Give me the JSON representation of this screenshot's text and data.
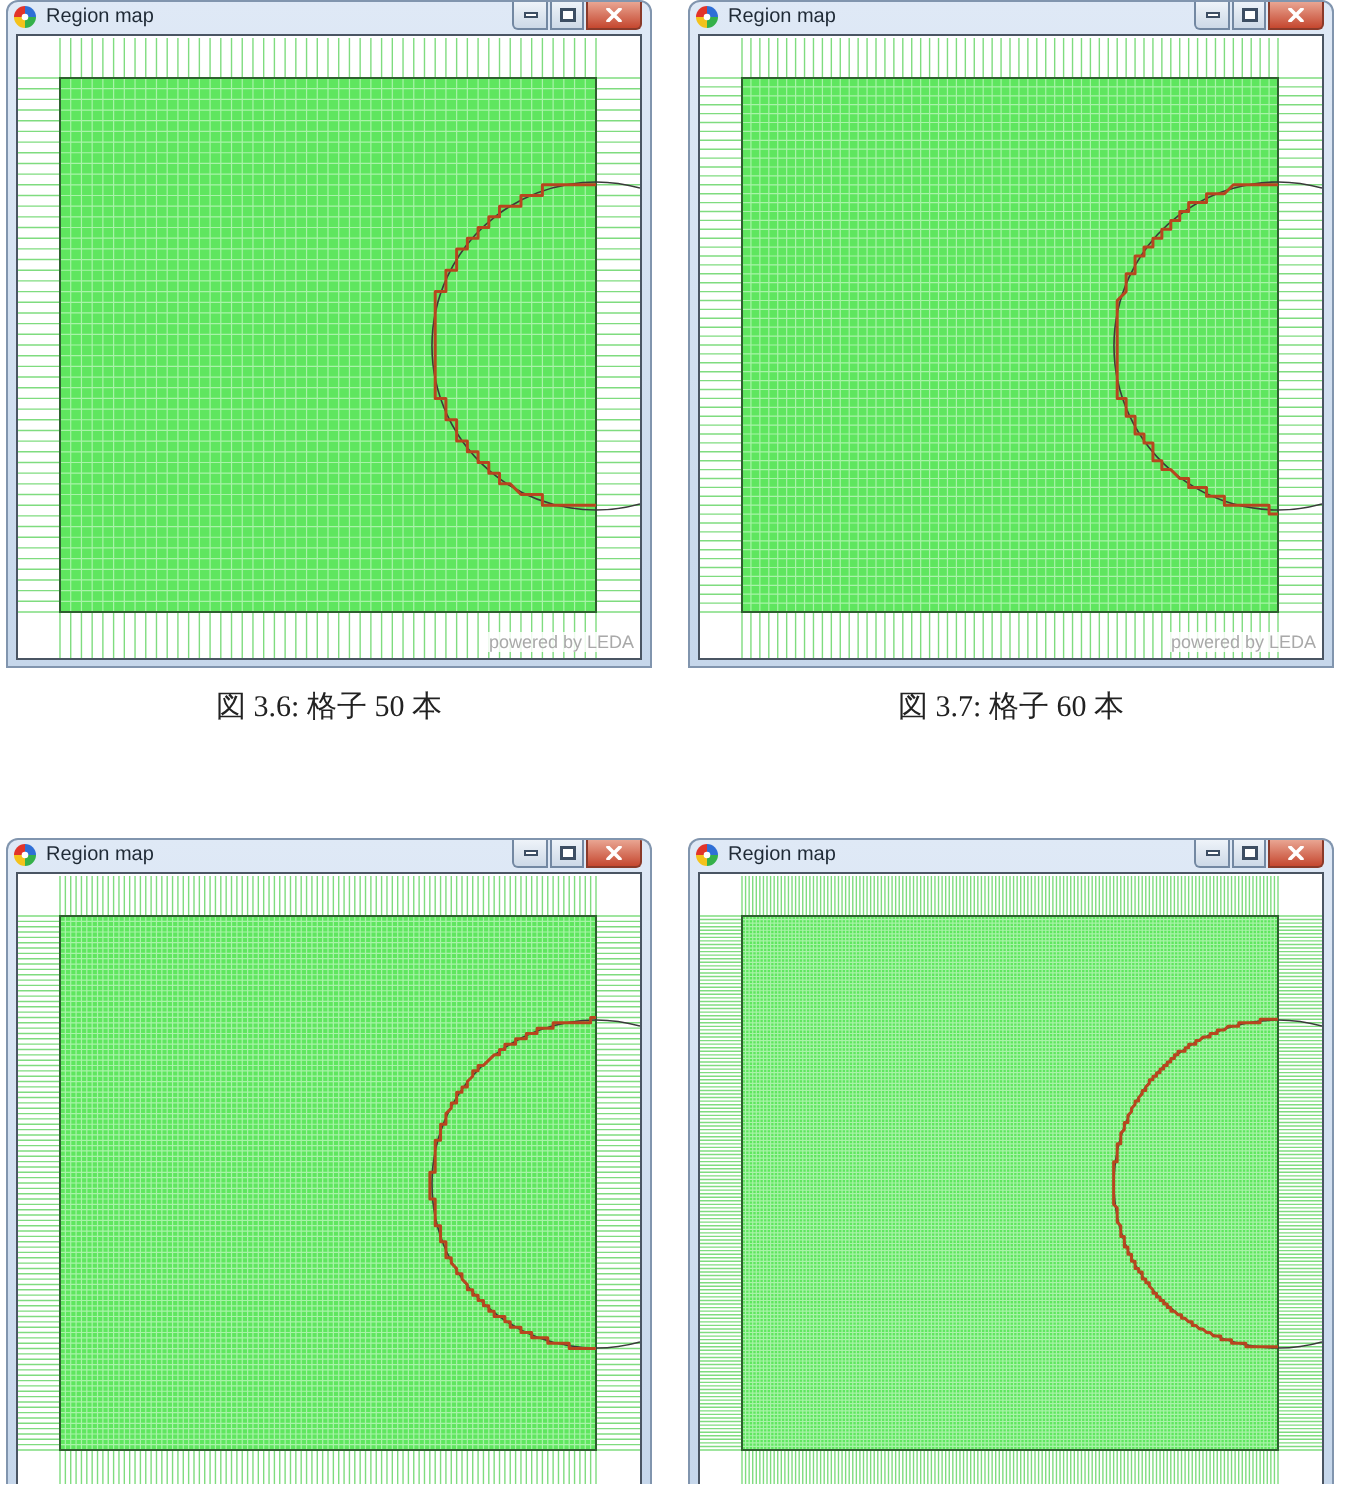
{
  "figures": [
    {
      "window": {
        "title": "Region map"
      },
      "map": {
        "kind": "coarse",
        "credit": "powered by LEDA"
      },
      "caption": "図 3.6: 格子 50 本"
    },
    {
      "window": {
        "title": "Region map"
      },
      "map": {
        "kind": "medium",
        "credit": "powered by LEDA"
      },
      "caption": "図 3.7: 格子 60 本"
    },
    {
      "window": {
        "title": "Region map"
      },
      "map": {
        "kind": "fine"
      }
    },
    {
      "window": {
        "title": "Region map"
      },
      "map": {
        "kind": "finest"
      }
    }
  ]
}
